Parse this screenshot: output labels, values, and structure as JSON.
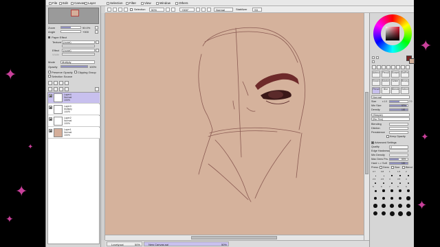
{
  "app": {
    "menu": [
      {
        "label": "File",
        "icon": "file-icon"
      },
      {
        "label": "Edit",
        "icon": "edit-icon"
      },
      {
        "label": "Canvas",
        "icon": "canvas-icon"
      },
      {
        "label": "Layer",
        "icon": "layer-icon"
      },
      {
        "label": "Selection",
        "icon": "selection-icon"
      },
      {
        "label": "Filter",
        "icon": "filter-icon"
      },
      {
        "label": "View",
        "icon": "view-icon"
      },
      {
        "label": "Window",
        "icon": "window-icon"
      },
      {
        "label": "Others",
        "icon": "others-icon"
      }
    ]
  },
  "toolbar": {
    "selection_label": "Selection",
    "zoom": "50%",
    "rotation": "+000°",
    "blend_mode": "Normal",
    "stabilizer_label": "Stabilizer",
    "stabilizer_value": "S3"
  },
  "left_panel": {
    "zoom_label": "Zoom",
    "zoom_value": "50.0%",
    "angle_label": "Angle",
    "angle_value": "+000",
    "section_title": "Paper Effect",
    "texture_label": "Texture",
    "texture_value": "(none)",
    "effect_label": "Effect",
    "effect_value": "(none)",
    "width_label": "Width",
    "width_value": "",
    "mode_label": "Mode",
    "mode_value": "Multiply",
    "opacity_label": "Opacity",
    "opacity_value": "100%",
    "opacity_fill": 1.0,
    "preserve_opacity": "Preserve Opacity",
    "clipping_group": "Clipping Group",
    "selection_source": "Selection Source",
    "layers": [
      {
        "name": "Layer4",
        "mode": "Normal",
        "opacity": "100%",
        "thumb": "#ffffff",
        "selected": true
      },
      {
        "name": "Layer3",
        "mode": "Multiply",
        "opacity": "100%",
        "thumb": "#ffffff",
        "selected": false
      },
      {
        "name": "Layer2",
        "mode": "Normal",
        "opacity": "100%",
        "thumb": "#ffffff",
        "selected": false
      },
      {
        "name": "Layer1",
        "mode": "Normal",
        "opacity": "100%",
        "thumb": "#d4ae9a",
        "selected": false
      }
    ]
  },
  "taskbar": {
    "tabs": [
      {
        "name": "Lovely.sai",
        "zoom": "50%",
        "active": false
      },
      {
        "name": "New Canvas.sai",
        "zoom": "50%",
        "active": true
      }
    ]
  },
  "right_panel": {
    "colors": {
      "foreground": "#7a2020",
      "background": "#d5b29c",
      "canvas": "#d5b29c"
    },
    "tools_row1": [
      "Airbrush",
      "Pencil",
      "Eraser",
      "SelPen"
    ],
    "tools_row2": [
      "Brush",
      "Marker",
      "Water",
      "Binary"
    ],
    "tools_row3": [
      "Pencil",
      "Blur",
      "Blender",
      "Select"
    ],
    "blend_mode": "Normal",
    "size_label": "Size",
    "size_value": "x 1.0",
    "size_number": "7.0",
    "min_size_label": "Min Size",
    "min_size_value": "97%",
    "density_label": "Density",
    "density_value": "100",
    "texture_a": "(Simple)",
    "texture_b": "(No Tex)",
    "blending_label": "Blending",
    "dilution_label": "Dilution",
    "persistence_label": "Persistence",
    "keep_opacity": "Keep Opacity",
    "advanced": "Advanced Settings",
    "quality_label": "Quality",
    "quality_value": "2",
    "edge_label": "Edge Hardness",
    "min_density_label": "Min Density",
    "max_dens_label": "Max Dens Prs.",
    "max_dens_value": "50%",
    "hard_soft_label": "Hard <-> Soft",
    "hard_soft_value": "100",
    "press_label": "Press:",
    "press_dens": "Dens",
    "press_size": "Size",
    "press_blend": "Blend",
    "brush_sizes": [
      "0.7",
      "0.8",
      "1",
      "1.5",
      "2",
      "2.3",
      "2.6",
      "3",
      "3.5",
      "4",
      "5",
      "6",
      "7",
      "8",
      "9",
      "10",
      "12",
      "14",
      "16",
      "20",
      "25",
      "30",
      "35",
      "40",
      "50",
      "60",
      "70",
      "80",
      "100",
      "120"
    ]
  }
}
